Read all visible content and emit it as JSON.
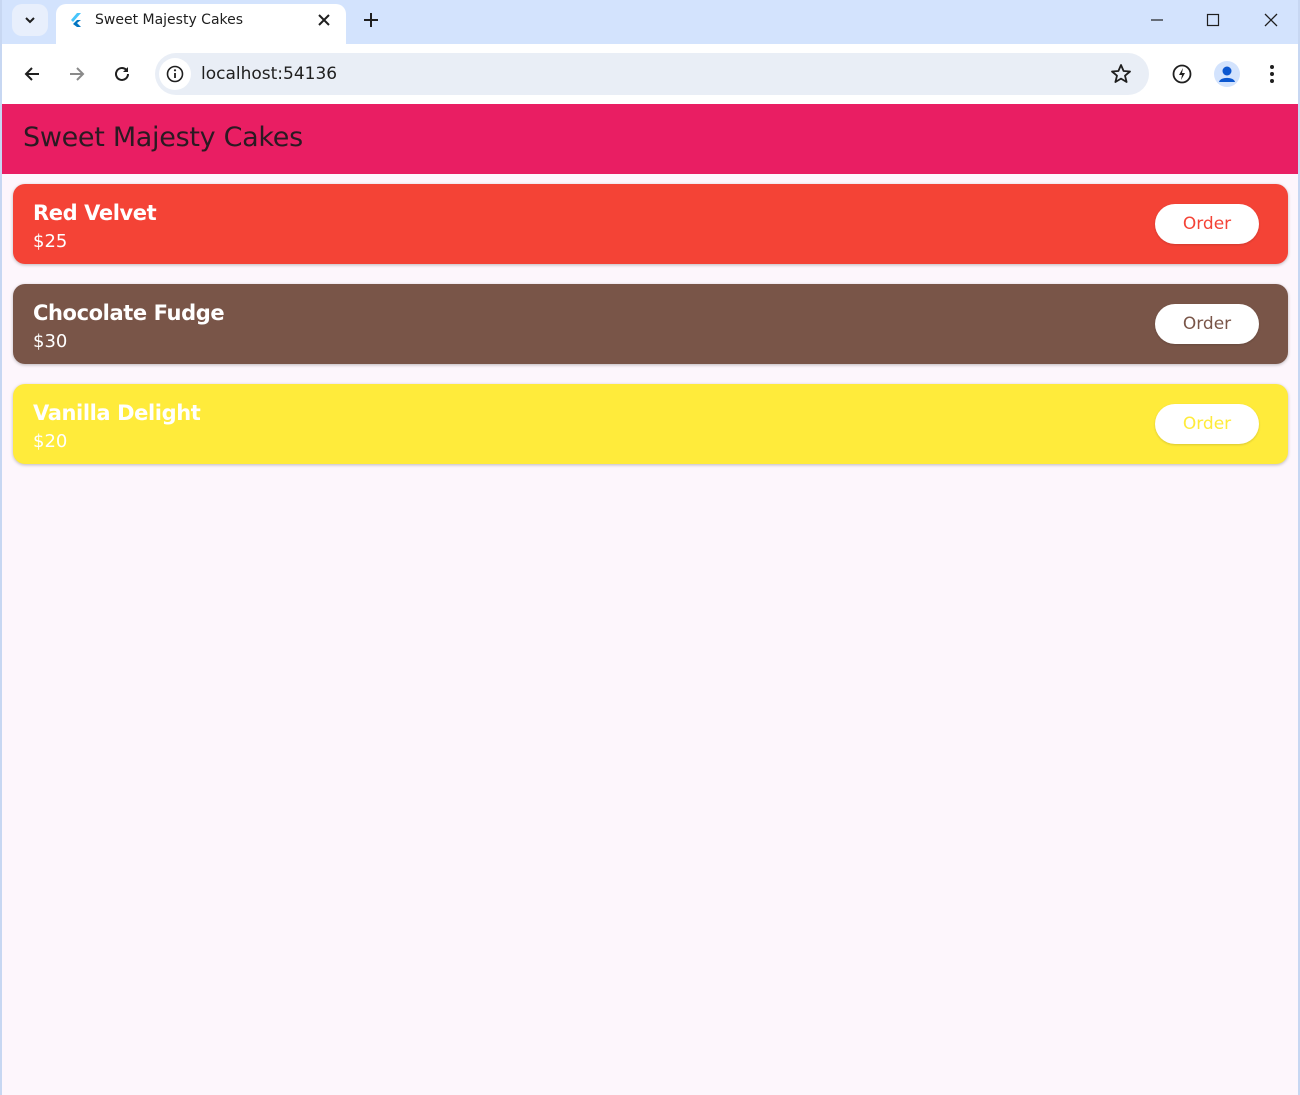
{
  "browser": {
    "tab_title": "Sweet Majesty Cakes",
    "url": "localhost:54136"
  },
  "app": {
    "title": "Sweet Majesty Cakes",
    "appbar_color": "#e91e63",
    "cakes": [
      {
        "name": "Red Velvet",
        "price": "$25",
        "button": "Order",
        "color": "#f44336"
      },
      {
        "name": "Chocolate Fudge",
        "price": "$30",
        "button": "Order",
        "color": "#795548"
      },
      {
        "name": "Vanilla Delight",
        "price": "$20",
        "button": "Order",
        "color": "#ffeb3b"
      }
    ]
  }
}
